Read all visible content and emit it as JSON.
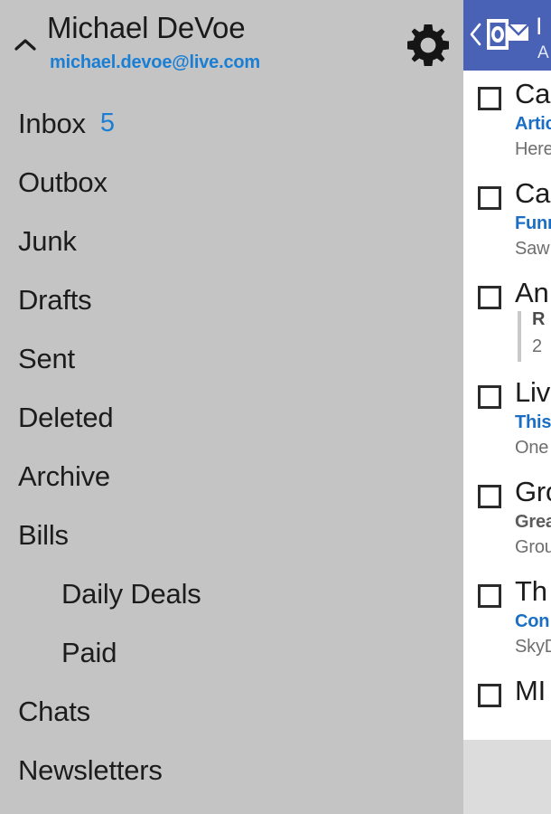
{
  "account": {
    "name": "Michael DeVoe",
    "email": "michael.devoe@live.com",
    "collapse_icon": "chevron-up-icon",
    "settings_icon": "gear-icon"
  },
  "folders": [
    {
      "label": "Inbox",
      "count": "5",
      "indent": false
    },
    {
      "label": "Outbox",
      "count": "",
      "indent": false
    },
    {
      "label": "Junk",
      "count": "",
      "indent": false
    },
    {
      "label": "Drafts",
      "count": "",
      "indent": false
    },
    {
      "label": "Sent",
      "count": "",
      "indent": false
    },
    {
      "label": "Deleted",
      "count": "",
      "indent": false
    },
    {
      "label": "Archive",
      "count": "",
      "indent": false
    },
    {
      "label": "Bills",
      "count": "",
      "indent": false
    },
    {
      "label": "Daily Deals",
      "count": "",
      "indent": true
    },
    {
      "label": "Paid",
      "count": "",
      "indent": true
    },
    {
      "label": "Chats",
      "count": "",
      "indent": false
    },
    {
      "label": "Newsletters",
      "count": "",
      "indent": false
    }
  ],
  "message_list": {
    "header": {
      "back_icon": "chevron-left-icon",
      "logo_icon": "outlook-logo-icon",
      "title": "I",
      "subtitle": "A"
    },
    "messages": [
      {
        "sender": "Ca",
        "subject": "Artic",
        "subject_unread": true,
        "preview": "Here",
        "threaded": false
      },
      {
        "sender": "Ca",
        "subject": "Funn",
        "subject_unread": true,
        "preview": "Saw",
        "threaded": false
      },
      {
        "sender": "An",
        "subject": "R",
        "subject_unread": false,
        "preview": "2",
        "threaded": true
      },
      {
        "sender": "Liv",
        "subject": "This",
        "subject_unread": true,
        "preview": "One",
        "threaded": false
      },
      {
        "sender": "Gro",
        "subject": "Grea",
        "subject_unread": false,
        "preview": "Grou",
        "threaded": false
      },
      {
        "sender": "Th",
        "subject": "Con",
        "subject_unread": true,
        "preview": "SkyD",
        "threaded": false
      },
      {
        "sender": "MI",
        "subject": "",
        "subject_unread": false,
        "preview": "",
        "threaded": false
      }
    ]
  },
  "colors": {
    "sidebar_bg": "#c4c4c4",
    "accent_blue": "#1a7fd4",
    "header_blue": "#4a62b5",
    "subject_blue": "#1a6fc4",
    "footer_gray": "#dcdcdc"
  }
}
